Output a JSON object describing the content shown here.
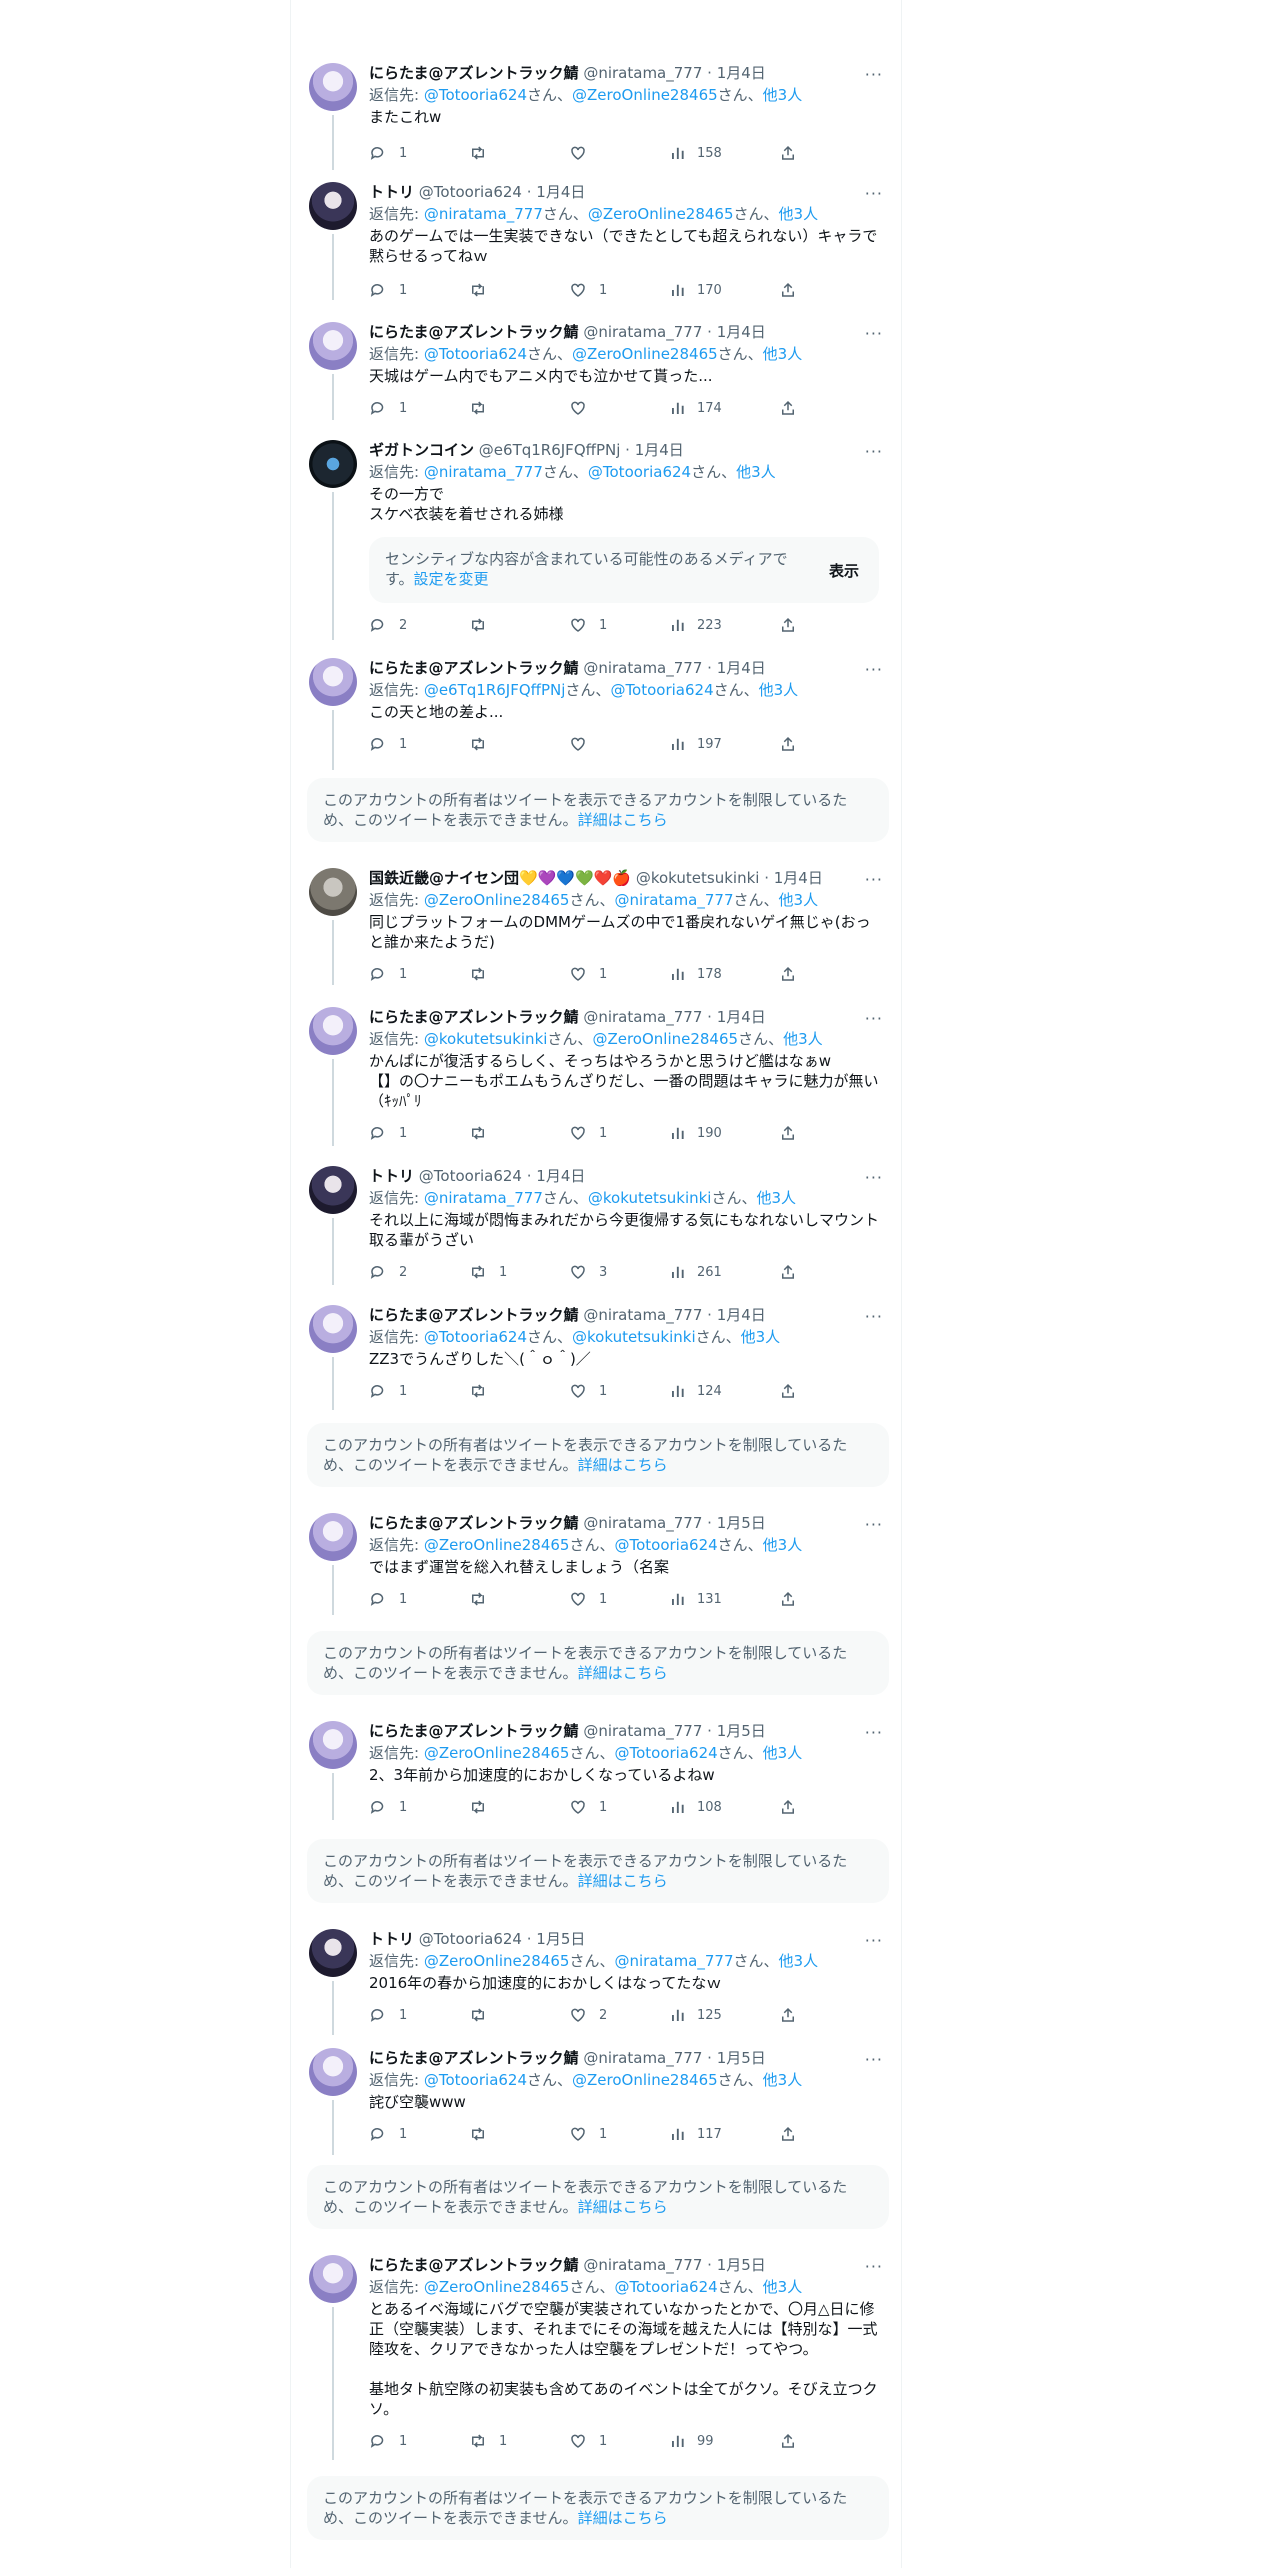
{
  "notice": {
    "text": "このアカウントの所有者はツイートを表示できるアカウントを制限しているため、このツイートを表示できません。",
    "link": "詳細はこちら"
  },
  "reply_prefix": "返信先: ",
  "reply_san": "さん、",
  "reply_san_end": "さん、",
  "others": "他3人",
  "tweets": [
    {
      "name": "にらたま@アズレントラック鯖",
      "handle": "@niratama_777 · 1月4日",
      "r1": "@Totooria624",
      "r2": "@ZeroOnline28465",
      "text": "またこれw",
      "reply": "1",
      "rt": "",
      "like": "",
      "views": "158"
    },
    {
      "name": "トトリ",
      "handle": "@Totooria624 · 1月4日",
      "r1": "@niratama_777",
      "r2": "@ZeroOnline28465",
      "text": "あのゲームでは一生実装できない（できたとしても超えられない）キャラで黙らせるってねｗ",
      "reply": "1",
      "rt": "",
      "like": "1",
      "views": "170"
    },
    {
      "name": "にらたま@アズレントラック鯖",
      "handle": "@niratama_777 · 1月4日",
      "r1": "@Totooria624",
      "r2": "@ZeroOnline28465",
      "text": "天城はゲーム内でもアニメ内でも泣かせて貰った...",
      "reply": "1",
      "rt": "",
      "like": "",
      "views": "174"
    },
    {
      "name": "ギガトンコイン",
      "handle": "@e6Tq1R6JFQffPNj · 1月4日",
      "r1": "@niratama_777",
      "r2": "@Totooria624",
      "text": "その一方で\nスケベ衣装を着せされる姉様",
      "reply": "2",
      "rt": "",
      "like": "1",
      "views": "223"
    },
    {
      "name": "にらたま@アズレントラック鯖",
      "handle": "@niratama_777 · 1月4日",
      "r1": "@e6Tq1R6JFQffPNj",
      "r2": "@Totooria624",
      "text": "この天と地の差よ...",
      "reply": "1",
      "rt": "",
      "like": "",
      "views": "197"
    },
    {
      "name": "国鉄近畿@ナイセン団💛💜💙💚❤️🍎",
      "handle": "@kokutetsukinki · 1月4日",
      "r1": "@ZeroOnline28465",
      "r2": "@niratama_777",
      "text": "同じプラットフォームのDMMゲームズの中で1番戻れないゲイ無じゃ(おっと誰か来たようだ)",
      "reply": "1",
      "rt": "",
      "like": "1",
      "views": "178"
    },
    {
      "name": "にらたま@アズレントラック鯖",
      "handle": "@niratama_777 · 1月4日",
      "r1": "@kokutetsukinki",
      "r2": "@ZeroOnline28465",
      "text": "かんぱにが復活するらしく、そっちはやろうかと思うけど艦はなぁw\n【】の〇ナニーもポエムもうんざりだし、一番の問題はキャラに魅力が無い（ｷｯﾊﾟﾘ",
      "reply": "1",
      "rt": "",
      "like": "1",
      "views": "190"
    },
    {
      "name": "トトリ",
      "handle": "@Totooria624 · 1月4日",
      "r1": "@niratama_777",
      "r2": "@kokutetsukinki",
      "text": "それ以上に海域が悶悔まみれだから今更復帰する気にもなれないしマウント取る輩がうざい",
      "reply": "2",
      "rt": "1",
      "like": "3",
      "views": "261"
    },
    {
      "name": "にらたま@アズレントラック鯖",
      "handle": "@niratama_777 · 1月4日",
      "r1": "@Totooria624",
      "r2": "@kokutetsukinki",
      "text": "ZZ3でうんざりした＼(＾ｏ＾)／",
      "reply": "1",
      "rt": "",
      "like": "1",
      "views": "124"
    },
    {
      "name": "にらたま@アズレントラック鯖",
      "handle": "@niratama_777 · 1月5日",
      "r1": "@ZeroOnline28465",
      "r2": "@Totooria624",
      "text": "ではまず運営を総入れ替えしましょう（名案",
      "reply": "1",
      "rt": "",
      "like": "1",
      "views": "131"
    },
    {
      "name": "にらたま@アズレントラック鯖",
      "handle": "@niratama_777 · 1月5日",
      "r1": "@ZeroOnline28465",
      "r2": "@Totooria624",
      "text": "2、3年前から加速度的におかしくなっているよねw",
      "reply": "1",
      "rt": "",
      "like": "1",
      "views": "108"
    },
    {
      "name": "トトリ",
      "handle": "@Totooria624 · 1月5日",
      "r1": "@ZeroOnline28465",
      "r2": "@niratama_777",
      "text": "2016年の春から加速度的におかしくはなってたなｗ",
      "reply": "1",
      "rt": "",
      "like": "2",
      "views": "125"
    },
    {
      "name": "にらたま@アズレントラック鯖",
      "handle": "@niratama_777 · 1月5日",
      "r1": "@Totooria624",
      "r2": "@ZeroOnline28465",
      "text": "詫び空襲www",
      "reply": "1",
      "rt": "",
      "like": "1",
      "views": "117"
    },
    {
      "name": "にらたま@アズレントラック鯖",
      "handle": "@niratama_777 · 1月5日",
      "r1": "@ZeroOnline28465",
      "r2": "@Totooria624",
      "text": "とあるイベ海域にバグで空襲が実装されていなかったとかで、〇月△日に修正（空襲実装）します、それまでにその海域を越えた人には【特別な】一式陸攻を、クリアできなかった人は空襲をプレゼントだ！ってやつ。\n\n基地タト航空隊の初実装も含めてあのイベントは全てがクソ。そびえ立つクソ。",
      "reply": "1",
      "rt": "1",
      "like": "1",
      "views": "99"
    }
  ],
  "sensitive": {
    "text": "センシティブな内容が含まれている可能性のあるメディアです。",
    "link": "設定を変更",
    "button": "表示"
  },
  "more_icon": "···"
}
